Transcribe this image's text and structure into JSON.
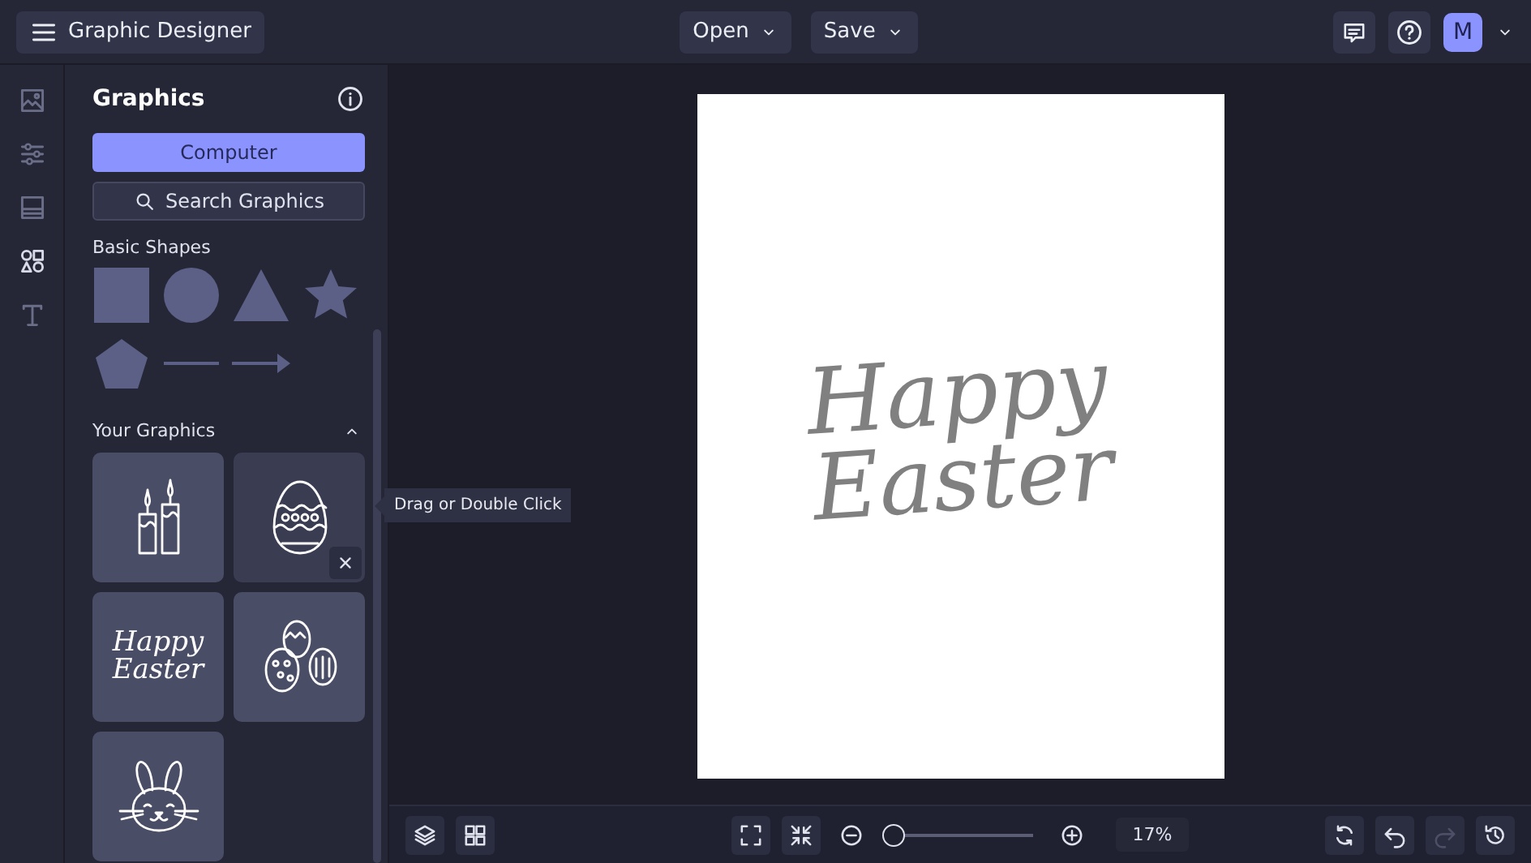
{
  "topbar": {
    "menu_label": "Graphic Designer",
    "menus": [
      {
        "label": "Open"
      },
      {
        "label": "Save"
      }
    ],
    "avatar": "M"
  },
  "rail": [
    {
      "kind": "image",
      "selected": false
    },
    {
      "kind": "sliders",
      "selected": false
    },
    {
      "kind": "layout",
      "selected": false
    },
    {
      "kind": "shapes",
      "selected": true
    },
    {
      "kind": "text",
      "selected": false
    }
  ],
  "panel": {
    "title": "Graphics",
    "computer_button": "Computer",
    "search_button": "Search Graphics",
    "basic_shapes_title": "Basic Shapes",
    "shapes": [
      {
        "kind": "square"
      },
      {
        "kind": "circle"
      },
      {
        "kind": "triangle"
      },
      {
        "kind": "star"
      },
      {
        "kind": "pentagon"
      },
      {
        "kind": "line"
      },
      {
        "kind": "arrow"
      }
    ],
    "your_graphics_title": "Your Graphics",
    "expanded": true,
    "graphics": [
      {
        "kind": "candles",
        "hovered": false
      },
      {
        "kind": "egg",
        "hovered": true
      },
      {
        "kind": "lettering",
        "text": "Happy Easter",
        "hovered": false
      },
      {
        "kind": "eggs",
        "hovered": false
      },
      {
        "kind": "bunny",
        "hovered": false
      }
    ],
    "tooltip": "Drag or Double Click"
  },
  "canvas": {
    "lettering": "Happy Easter"
  },
  "bottom": {
    "zoom": {
      "level": 0.0,
      "reading": "17%"
    },
    "redo_disabled": true
  }
}
